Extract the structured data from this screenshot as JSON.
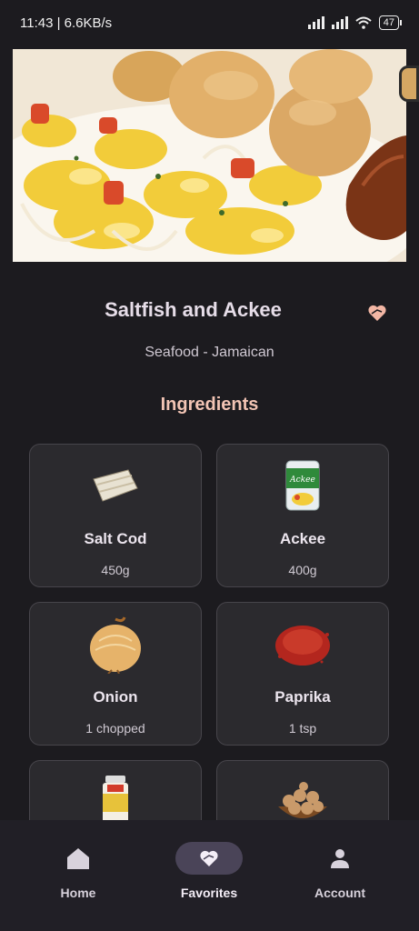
{
  "status_bar": {
    "time_speed": "11:43 | 6.6KB/s",
    "battery": "47"
  },
  "recipe": {
    "title": "Saltfish and Ackee",
    "subtitle": "Seafood - Jamaican",
    "section_title": "Ingredients"
  },
  "ingredients": [
    {
      "name": "Salt Cod",
      "qty": "450g",
      "icon": "salt-cod-image"
    },
    {
      "name": "Ackee",
      "qty": "400g",
      "icon": "ackee-can-image"
    },
    {
      "name": "Onion",
      "qty": "1 chopped",
      "icon": "onion-image"
    },
    {
      "name": "Paprika",
      "qty": "1 tsp",
      "icon": "paprika-image"
    },
    {
      "name": "",
      "qty": "",
      "icon": "curry-jar-image"
    },
    {
      "name": "",
      "qty": "",
      "icon": "nuts-bowl-image"
    }
  ],
  "nav": {
    "home": "Home",
    "favorites": "Favorites",
    "account": "Account"
  },
  "colors": {
    "background": "#1c1b1f",
    "accent": "#f2c4b4",
    "card": "#2b2a2e",
    "active_pill": "#4a4458"
  }
}
